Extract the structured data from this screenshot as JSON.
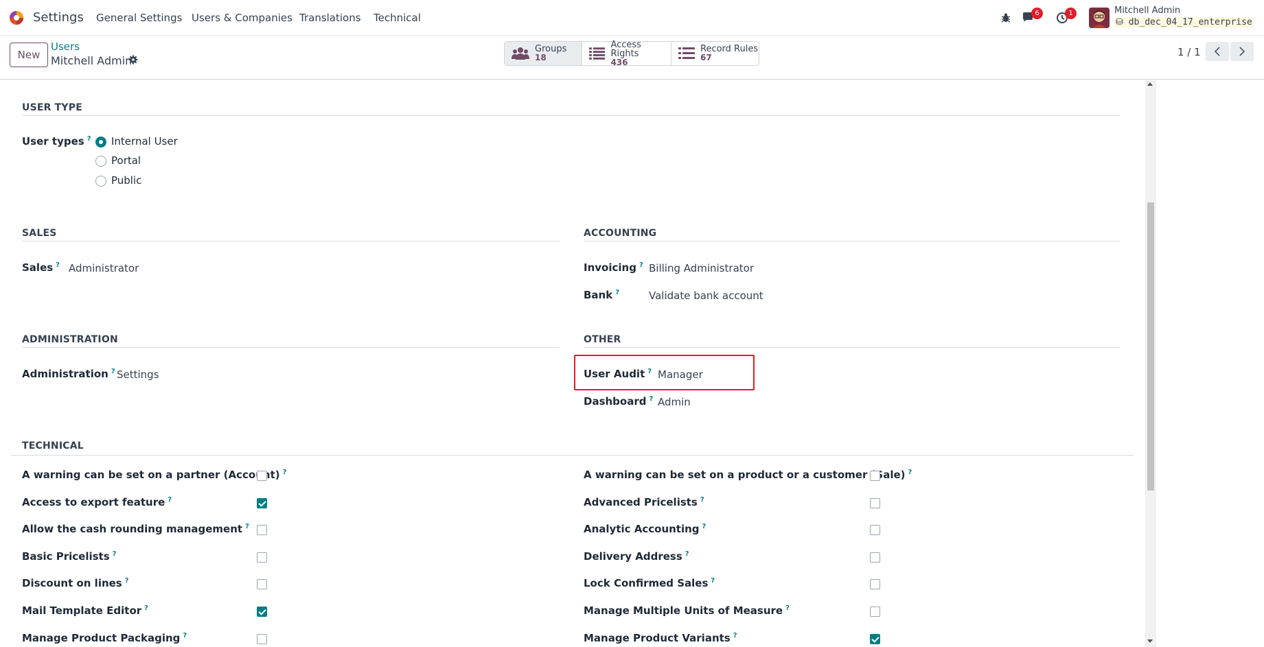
{
  "navbar": {
    "app_name": "Settings",
    "menu": [
      "General Settings",
      "Users & Companies",
      "Translations",
      "Technical"
    ],
    "chat_badge": "6",
    "activity_badge": "1",
    "user_name": "Mitchell Admin",
    "database": "db_dec_04_17_enterprise"
  },
  "control": {
    "new_label": "New",
    "breadcrumb_parent": "Users",
    "breadcrumb_current": "Mitchell Admin",
    "smart_buttons": [
      {
        "label": "Groups",
        "count": "18",
        "icon": "users-icon"
      },
      {
        "label": "Access Rights",
        "count": "436",
        "icon": "list-icon"
      },
      {
        "label": "Record Rules",
        "count": "67",
        "icon": "list-icon"
      }
    ],
    "pager": "1 / 1"
  },
  "form": {
    "help_mark": "?",
    "user_type": {
      "title": "USER TYPE",
      "label": "User types",
      "options": [
        "Internal User",
        "Portal",
        "Public"
      ],
      "selected": "Internal User"
    },
    "sales": {
      "title": "SALES",
      "label": "Sales",
      "value": "Administrator"
    },
    "accounting": {
      "title": "ACCOUNTING",
      "invoicing_label": "Invoicing",
      "invoicing_value": "Billing Administrator",
      "bank_label": "Bank",
      "bank_value": "Validate bank account"
    },
    "administration": {
      "title": "ADMINISTRATION",
      "label": "Administration",
      "value": "Settings"
    },
    "other": {
      "title": "OTHER",
      "user_audit_label": "User Audit",
      "user_audit_value": "Manager",
      "dashboard_label": "Dashboard",
      "dashboard_value": "Admin"
    },
    "technical": {
      "title": "TECHNICAL",
      "left": [
        {
          "label": "A warning can be set on a partner (Account)",
          "checked": false
        },
        {
          "label": "Access to export feature",
          "checked": true
        },
        {
          "label": "Allow the cash rounding management",
          "checked": false
        },
        {
          "label": "Basic Pricelists",
          "checked": false
        },
        {
          "label": "Discount on lines",
          "checked": false
        },
        {
          "label": "Mail Template Editor",
          "checked": true
        },
        {
          "label": "Manage Product Packaging",
          "checked": false
        }
      ],
      "right": [
        {
          "label": "A warning can be set on a product or a customer (Sale)",
          "checked": false
        },
        {
          "label": "Advanced Pricelists",
          "checked": false
        },
        {
          "label": "Analytic Accounting",
          "checked": false
        },
        {
          "label": "Delivery Address",
          "checked": false
        },
        {
          "label": "Lock Confirmed Sales",
          "checked": false
        },
        {
          "label": "Manage Multiple Units of Measure",
          "checked": false
        },
        {
          "label": "Manage Product Variants",
          "checked": true
        }
      ]
    }
  },
  "colors": {
    "brand": "#714b67",
    "accent": "#017e84",
    "badge": "#e11d2a",
    "highlight_box": "#e11d1d"
  }
}
